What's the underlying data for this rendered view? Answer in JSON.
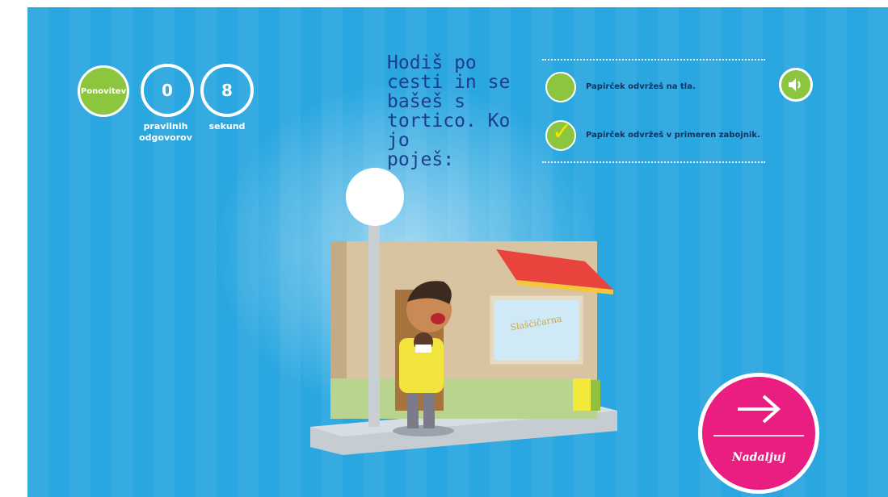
{
  "stats": {
    "restart_label": "Ponovitev",
    "errors_value": "0",
    "errors_label": "pravilnih\nodgovorov",
    "seconds_value": "8",
    "seconds_label": "sekund"
  },
  "question": "Hodiš po\ncesti in se\nbašeš s\ntortico. Ko jo\npoješ:",
  "options": [
    {
      "label": "Papirček odvržeš na tla.",
      "checked": false
    },
    {
      "label": "Papirček odvržeš v primeren zabojnik.",
      "checked": true
    }
  ],
  "scene": {
    "shop_sign": "Slaščičarna"
  },
  "next_label": "Nadaljuj",
  "icons": {
    "sound": "speaker-icon",
    "next": "arrow-right-icon",
    "check": "checkmark-icon"
  },
  "colors": {
    "background": "#2aa7e0",
    "green": "#8cc63e",
    "next_button": "#e91e80",
    "question_text": "#1f3c8a"
  }
}
